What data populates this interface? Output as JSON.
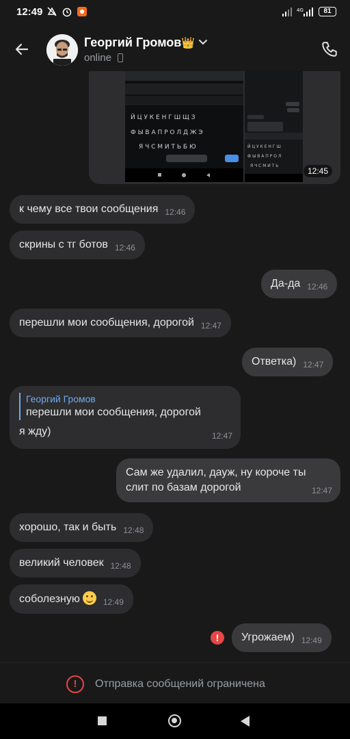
{
  "status_bar": {
    "time": "12:49",
    "network": "4G",
    "battery": "81"
  },
  "header": {
    "contact_name": "Георгий Громов",
    "status": "online"
  },
  "image_message": {
    "time": "12:45"
  },
  "messages": [
    {
      "dir": "in",
      "text": "к чему все твои сообщения",
      "time": "12:46"
    },
    {
      "dir": "in",
      "text": "скрины с тг ботов",
      "time": "12:46"
    },
    {
      "dir": "out",
      "text": "Да-да",
      "time": "12:46"
    },
    {
      "dir": "in",
      "text": "перешли мои сообщения, дорогой",
      "time": "12:47"
    },
    {
      "dir": "out",
      "text": "Ответка)",
      "time": "12:47"
    },
    {
      "dir": "in",
      "reply_name": "Георгий Громов",
      "reply_text": "перешли мои сообщения, дорогой",
      "text": "я жду)",
      "time": "12:47"
    },
    {
      "dir": "out",
      "text": "Сам же удалил, дауж, ну короче ты слит по базам дорогой",
      "time": "12:47"
    },
    {
      "dir": "in",
      "text": "хорошо, так и быть",
      "time": "12:48"
    },
    {
      "dir": "in",
      "text": "великий человек",
      "time": "12:48"
    },
    {
      "dir": "in",
      "text": "соболезную",
      "time": "12:49"
    },
    {
      "dir": "out",
      "text": "Угрожаем)",
      "time": "12:49"
    }
  ],
  "restriction": {
    "text": "Отправка сообщений ограничена"
  },
  "colors": {
    "background": "#19191a",
    "incoming_bubble": "#2d2d2f",
    "outgoing_bubble": "#3a3a3c",
    "accent": "#71aaeb",
    "error": "#e64646"
  }
}
